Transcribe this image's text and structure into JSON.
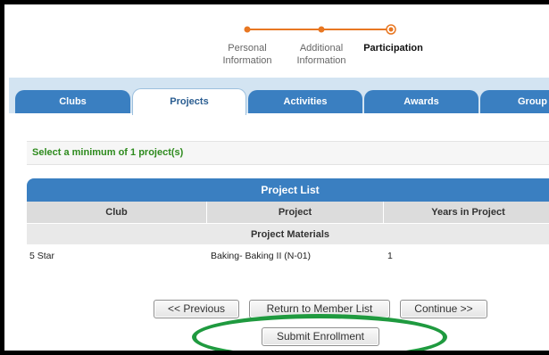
{
  "steps": [
    {
      "label_line1": "Personal",
      "label_line2": "Information",
      "state": "done"
    },
    {
      "label_line1": "Additional",
      "label_line2": "Information",
      "state": "done"
    },
    {
      "label_line1": "Participation",
      "label_line2": "",
      "state": "current"
    }
  ],
  "colors": {
    "tab_blue": "#3a7fc1",
    "tab_strip": "#d3e4f2",
    "progress_orange": "#e87722",
    "notice_green": "#2e8b1e",
    "highlight_green": "#1f9a3f"
  },
  "tabs": [
    {
      "label": "Clubs",
      "active": false
    },
    {
      "label": "Projects",
      "active": true
    },
    {
      "label": "Activities",
      "active": false
    },
    {
      "label": "Awards",
      "active": false
    },
    {
      "label": "Group",
      "active": false
    }
  ],
  "notice": "Select a minimum of 1 project(s)",
  "project_list": {
    "title": "Project List",
    "columns": [
      "Club",
      "Project",
      "Years in Project"
    ],
    "group_label": "Project Materials",
    "rows": [
      {
        "club": "5 Star",
        "project": "Baking- Baking II (N-01)",
        "years": "1"
      }
    ]
  },
  "buttons": {
    "previous": "<< Previous",
    "return": "Return to Member List",
    "continue": "Continue >>",
    "submit": "Submit Enrollment"
  }
}
